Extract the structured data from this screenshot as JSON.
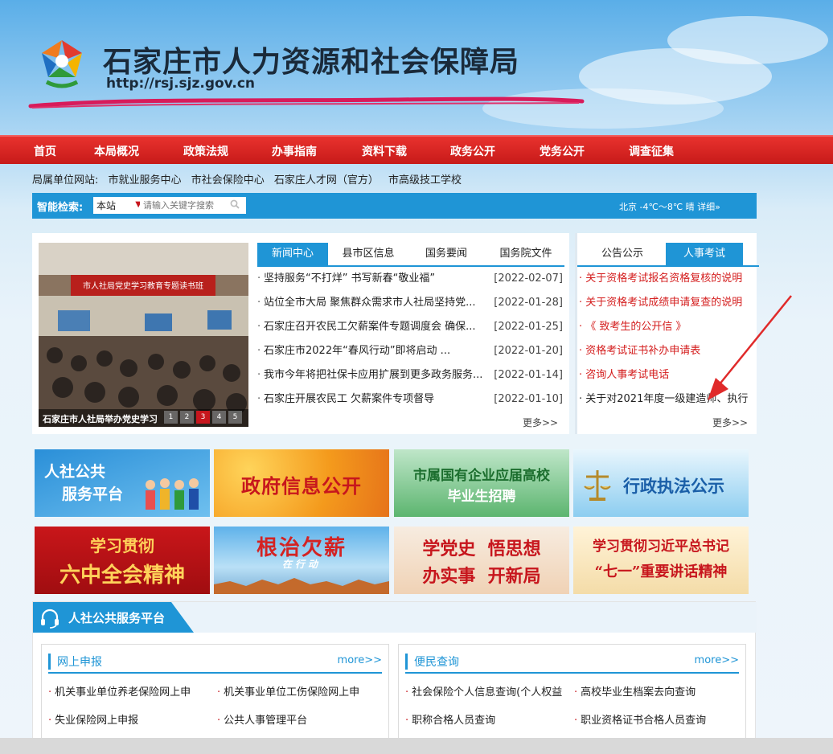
{
  "header": {
    "title": "石家庄市人力资源和社会保障局",
    "url": "http://rsj.sjz.gov.cn"
  },
  "nav": [
    "首页",
    "本局概况",
    "政策法规",
    "办事指南",
    "资料下载",
    "政务公开",
    "党务公开",
    "调查征集"
  ],
  "sub_links": {
    "label": "局属单位网站:",
    "items": [
      "市就业服务中心",
      "市社会保险中心",
      "石家庄人才网（官方）",
      "市高级技工学校"
    ]
  },
  "search": {
    "label": "智能检索:",
    "scope": "本站",
    "placeholder": "请输入关键字搜索",
    "weather": "北京 -4℃～8℃ 晴 详细»"
  },
  "photo": {
    "caption": "石家庄市人社局举办党史学习",
    "banner": "市人社局党史学习教育专题读书班",
    "pages": [
      "1",
      "2",
      "3",
      "4",
      "5"
    ],
    "active_page": 3
  },
  "news": {
    "tabs": [
      "新闻中心",
      "县市区信息",
      "国务要闻",
      "国务院文件"
    ],
    "items": [
      {
        "title": "坚持服务“不打烊” 书写新春“敬业福”",
        "date": "[2022-02-07]"
      },
      {
        "title": "站位全市大局 聚焦群众需求市人社局坚持党...",
        "date": "[2022-01-28]"
      },
      {
        "title": "石家庄召开农民工欠薪案件专题调度会 确保...",
        "date": "[2022-01-25]"
      },
      {
        "title": "石家庄市2022年“春风行动”即将启动 ...",
        "date": "[2022-01-20]"
      },
      {
        "title": "我市今年将把社保卡应用扩展到更多政务服务...",
        "date": "[2022-01-14]"
      },
      {
        "title": "石家庄开展农民工 欠薪案件专项督导",
        "date": "[2022-01-10]"
      }
    ],
    "more": "更多>>"
  },
  "notices": {
    "tabs": [
      "公告公示",
      "人事考试"
    ],
    "items": [
      "关于资格考试报名资格复核的说明",
      "关于资格考试成绩申请复查的说明",
      "《 致考生的公开信 》",
      "资格考试证书补办申请表",
      "咨询人事考试电话",
      "关于对2021年度一级建造师、执行"
    ],
    "more": "更多>>"
  },
  "banners": [
    {
      "line1": "人社公共",
      "line2": "服务平台"
    },
    {
      "line1": "政府信息公开",
      "line2": ""
    },
    {
      "line1": "市属国有企业应届高校",
      "line2": "毕业生招聘"
    },
    {
      "line1": "行政执法公示",
      "line2": ""
    },
    {
      "line1": "学习贯彻",
      "line2": "六中全会精神"
    },
    {
      "line1": "根治欠薪",
      "line2": "在行动"
    },
    {
      "line1": "学党史  悟思想",
      "line2": "办实事  开新局"
    },
    {
      "line1": "学习贯彻习近平总书记",
      "line2": "“七一”重要讲话精神"
    }
  ],
  "platform": {
    "title": "人社公共服务平台",
    "left": {
      "title": "网上申报",
      "more": "more>>",
      "items": [
        "机关事业单位养老保险网上申",
        "机关事业单位工伤保险网上申",
        "失业保险网上申报",
        "公共人事管理平台"
      ]
    },
    "right": {
      "title": "便民查询",
      "more": "more>>",
      "items": [
        "社会保险个人信息查询(个人权益",
        "高校毕业生档案去向查询",
        "职称合格人员查询",
        "职业资格证书合格人员查询"
      ]
    }
  },
  "colors": {
    "accent": "#1f95d6",
    "nav_red": "#c7161d",
    "notice_red": "#d41d1d"
  }
}
